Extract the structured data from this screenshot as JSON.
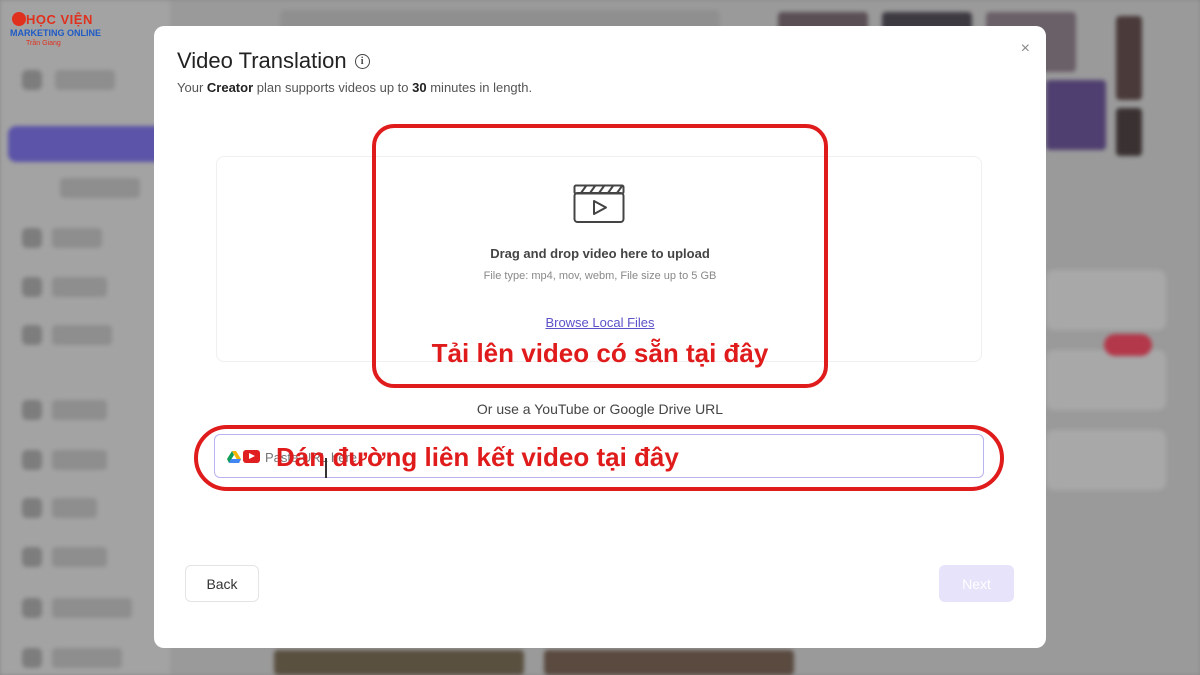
{
  "logo": {
    "main": "HỌC VIỆN",
    "sub": "MARKETING ONLINE",
    "tag": "Trần Giang"
  },
  "modal": {
    "title": "Video Translation",
    "subtitle_prefix": "Your ",
    "plan_name": "Creator",
    "subtitle_mid": " plan supports videos up to ",
    "max_minutes": "30",
    "subtitle_suffix": " minutes in length.",
    "close_label": "×"
  },
  "upload": {
    "title": "Drag and drop video here to upload",
    "hint": "File type: mp4, mov, webm, File size up to 5 GB",
    "browse_label": "Browse Local Files",
    "icon": "video-clapper-icon"
  },
  "url": {
    "or_text": "Or use a YouTube or Google Drive URL",
    "placeholder": "Paste URL here",
    "icons": [
      "google-drive-icon",
      "youtube-icon"
    ]
  },
  "buttons": {
    "back_label": "Back",
    "next_label": "Next"
  },
  "annotations": {
    "upload_note": "Tải lên video có sẵn tại đây",
    "url_note": "Dán đường liên kết video tại đây",
    "color": "#e01b1b"
  },
  "colors": {
    "accent": "#5b52c9",
    "next_disabled_bg": "#e6e3fb",
    "input_border": "#b9b3f0"
  }
}
